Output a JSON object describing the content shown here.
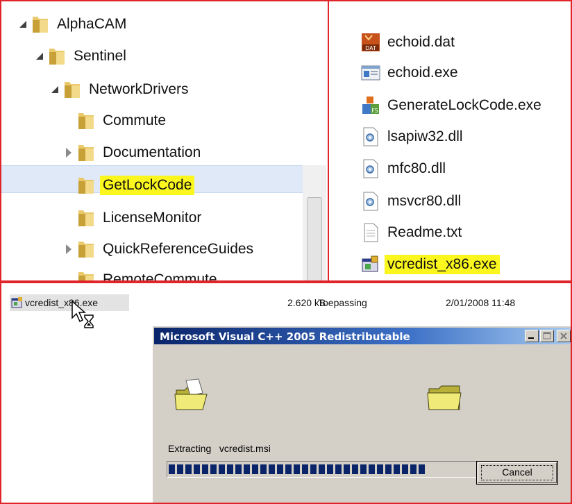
{
  "tree": {
    "items": [
      {
        "label": "AlphaCAM",
        "expander": "open"
      },
      {
        "label": "Sentinel",
        "expander": "open"
      },
      {
        "label": "NetworkDrivers",
        "expander": "open"
      },
      {
        "label": "Commute",
        "expander": "none"
      },
      {
        "label": "Documentation",
        "expander": "closed"
      },
      {
        "label": "GetLockCode",
        "expander": "none",
        "selected": true,
        "highlighted": true
      },
      {
        "label": "LicenseMonitor",
        "expander": "none"
      },
      {
        "label": "QuickReferenceGuides",
        "expander": "closed"
      },
      {
        "label": "RemoteCommute",
        "expander": "none"
      }
    ]
  },
  "files": {
    "items": [
      {
        "name": "echoid.dat",
        "icon": "dat-file-icon"
      },
      {
        "name": "echoid.exe",
        "icon": "exe-window-icon"
      },
      {
        "name": "GenerateLockCode.exe",
        "icon": "installer-exe-icon"
      },
      {
        "name": "lsapiw32.dll",
        "icon": "dll-gear-icon"
      },
      {
        "name": "mfc80.dll",
        "icon": "dll-gear-icon"
      },
      {
        "name": "msvcr80.dll",
        "icon": "dll-gear-icon"
      },
      {
        "name": "Readme.txt",
        "icon": "text-file-icon"
      },
      {
        "name": "vcredist_x86.exe",
        "icon": "setup-exe-icon",
        "highlighted": true
      }
    ]
  },
  "explorer_row": {
    "name": "vcredist_x86.exe",
    "size": "2.620 kB",
    "type": "Toepassing",
    "date": "2/01/2008 11:48"
  },
  "dialog": {
    "title": "Microsoft Visual C++ 2005 Redistributable",
    "status_label": "Extracting",
    "status_file": "vcredist.msi",
    "progress_percent": 83,
    "cancel_label": "Cancel"
  },
  "colors": {
    "frame_border": "#e0242a",
    "highlight": "#fbf71e",
    "selection": "#dfe9f7",
    "dialog_face": "#d4d0c8",
    "title_bar": "#0a246a",
    "progress_block": "#0a246a"
  }
}
